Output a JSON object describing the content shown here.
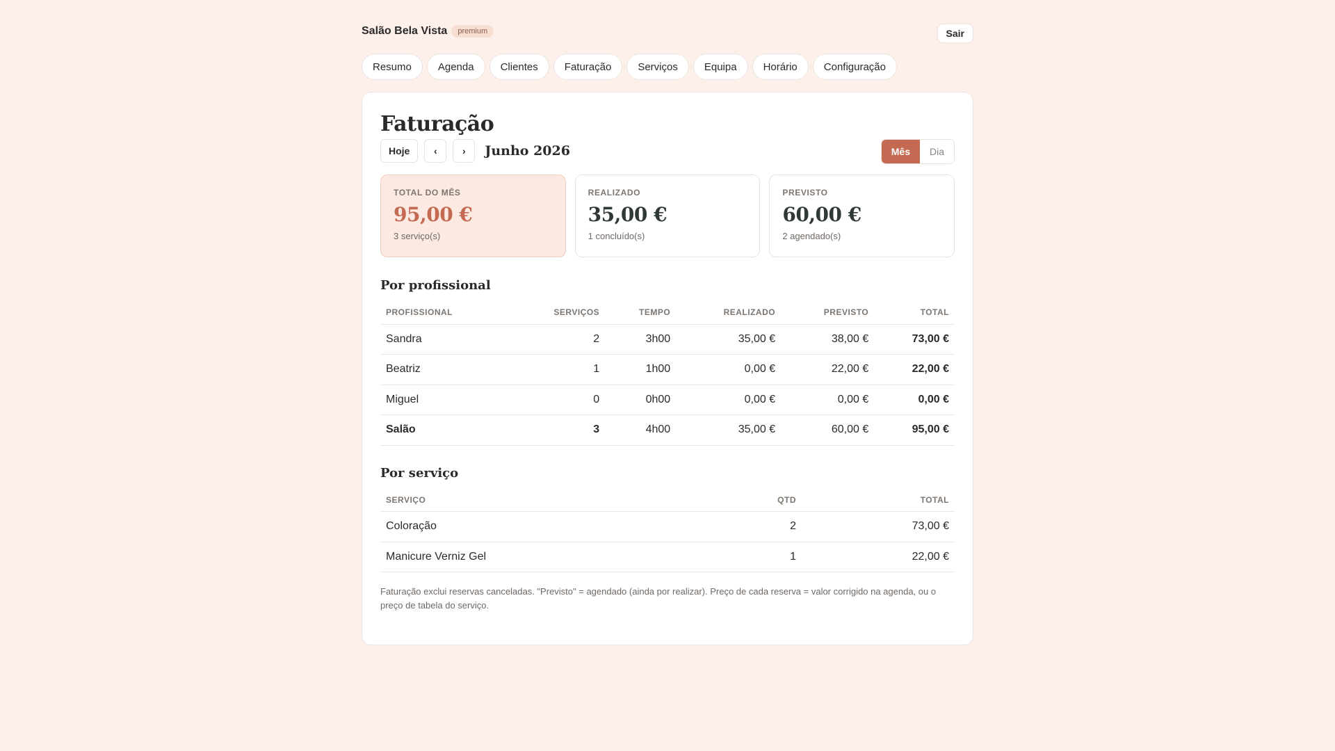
{
  "header": {
    "brand": "Salão Bela Vista",
    "badge": "premium",
    "logout_label": "Sair"
  },
  "nav": {
    "items": [
      "Resumo",
      "Agenda",
      "Clientes",
      "Faturação",
      "Serviços",
      "Equipa",
      "Horário",
      "Configuração"
    ]
  },
  "page": {
    "title": "Faturação",
    "today_label": "Hoje",
    "prev_label": "‹",
    "next_label": "›",
    "period": "Junho 2026",
    "view_toggle": {
      "month": "Mês",
      "day": "Dia",
      "selected": "Mês"
    }
  },
  "stats": [
    {
      "label": "TOTAL DO MÊS",
      "value": "95,00 €",
      "sub": "3 serviço(s)"
    },
    {
      "label": "REALIZADO",
      "value": "35,00 €",
      "sub": "1 concluído(s)"
    },
    {
      "label": "PREVISTO",
      "value": "60,00 €",
      "sub": "2 agendado(s)"
    }
  ],
  "by_professional": {
    "title": "Por profissional",
    "columns": [
      "PROFISSIONAL",
      "SERVIÇOS",
      "TEMPO",
      "REALIZADO",
      "PREVISTO",
      "TOTAL"
    ],
    "rows": [
      [
        "Sandra",
        "2",
        "3h00",
        "35,00 €",
        "38,00 €",
        "73,00 €"
      ],
      [
        "Beatriz",
        "1",
        "1h00",
        "0,00 €",
        "22,00 €",
        "22,00 €"
      ],
      [
        "Miguel",
        "0",
        "0h00",
        "0,00 €",
        "0,00 €",
        "0,00 €"
      ]
    ],
    "total_row": [
      "Salão",
      "3",
      "4h00",
      "35,00 €",
      "60,00 €",
      "95,00 €"
    ]
  },
  "by_service": {
    "title": "Por serviço",
    "columns": [
      "SERVIÇO",
      "QTD",
      "TOTAL"
    ],
    "rows": [
      [
        "Coloração",
        "2",
        "73,00 €"
      ],
      [
        "Manicure Verniz Gel",
        "1",
        "22,00 €"
      ]
    ]
  },
  "footnote": "Faturação exclui reservas canceladas. \"Previsto\" = agendado (ainda por realizar). Preço de cada reserva = valor corrigido na agenda, ou o preço de tabela do serviço."
}
